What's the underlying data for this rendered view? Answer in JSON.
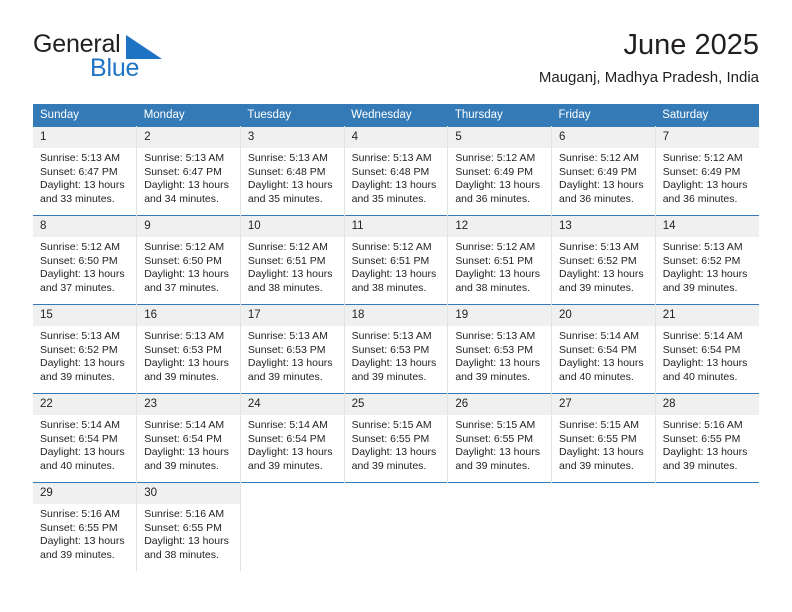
{
  "brand": {
    "name_part1": "General",
    "name_part2": "Blue",
    "logo_icon": "triangle-flag-icon",
    "accent_color": "#1f73c4"
  },
  "header": {
    "title": "June 2025",
    "location": "Mauganj, Madhya Pradesh, India"
  },
  "calendar": {
    "header_bg": "#337ab7",
    "daynum_bg": "#f0f0f0",
    "weekday_headers": [
      "Sunday",
      "Monday",
      "Tuesday",
      "Wednesday",
      "Thursday",
      "Friday",
      "Saturday"
    ],
    "weeks": [
      [
        {
          "day": "1",
          "sunrise": "Sunrise: 5:13 AM",
          "sunset": "Sunset: 6:47 PM",
          "daylight1": "Daylight: 13 hours",
          "daylight2": "and 33 minutes."
        },
        {
          "day": "2",
          "sunrise": "Sunrise: 5:13 AM",
          "sunset": "Sunset: 6:47 PM",
          "daylight1": "Daylight: 13 hours",
          "daylight2": "and 34 minutes."
        },
        {
          "day": "3",
          "sunrise": "Sunrise: 5:13 AM",
          "sunset": "Sunset: 6:48 PM",
          "daylight1": "Daylight: 13 hours",
          "daylight2": "and 35 minutes."
        },
        {
          "day": "4",
          "sunrise": "Sunrise: 5:13 AM",
          "sunset": "Sunset: 6:48 PM",
          "daylight1": "Daylight: 13 hours",
          "daylight2": "and 35 minutes."
        },
        {
          "day": "5",
          "sunrise": "Sunrise: 5:12 AM",
          "sunset": "Sunset: 6:49 PM",
          "daylight1": "Daylight: 13 hours",
          "daylight2": "and 36 minutes."
        },
        {
          "day": "6",
          "sunrise": "Sunrise: 5:12 AM",
          "sunset": "Sunset: 6:49 PM",
          "daylight1": "Daylight: 13 hours",
          "daylight2": "and 36 minutes."
        },
        {
          "day": "7",
          "sunrise": "Sunrise: 5:12 AM",
          "sunset": "Sunset: 6:49 PM",
          "daylight1": "Daylight: 13 hours",
          "daylight2": "and 36 minutes."
        }
      ],
      [
        {
          "day": "8",
          "sunrise": "Sunrise: 5:12 AM",
          "sunset": "Sunset: 6:50 PM",
          "daylight1": "Daylight: 13 hours",
          "daylight2": "and 37 minutes."
        },
        {
          "day": "9",
          "sunrise": "Sunrise: 5:12 AM",
          "sunset": "Sunset: 6:50 PM",
          "daylight1": "Daylight: 13 hours",
          "daylight2": "and 37 minutes."
        },
        {
          "day": "10",
          "sunrise": "Sunrise: 5:12 AM",
          "sunset": "Sunset: 6:51 PM",
          "daylight1": "Daylight: 13 hours",
          "daylight2": "and 38 minutes."
        },
        {
          "day": "11",
          "sunrise": "Sunrise: 5:12 AM",
          "sunset": "Sunset: 6:51 PM",
          "daylight1": "Daylight: 13 hours",
          "daylight2": "and 38 minutes."
        },
        {
          "day": "12",
          "sunrise": "Sunrise: 5:12 AM",
          "sunset": "Sunset: 6:51 PM",
          "daylight1": "Daylight: 13 hours",
          "daylight2": "and 38 minutes."
        },
        {
          "day": "13",
          "sunrise": "Sunrise: 5:13 AM",
          "sunset": "Sunset: 6:52 PM",
          "daylight1": "Daylight: 13 hours",
          "daylight2": "and 39 minutes."
        },
        {
          "day": "14",
          "sunrise": "Sunrise: 5:13 AM",
          "sunset": "Sunset: 6:52 PM",
          "daylight1": "Daylight: 13 hours",
          "daylight2": "and 39 minutes."
        }
      ],
      [
        {
          "day": "15",
          "sunrise": "Sunrise: 5:13 AM",
          "sunset": "Sunset: 6:52 PM",
          "daylight1": "Daylight: 13 hours",
          "daylight2": "and 39 minutes."
        },
        {
          "day": "16",
          "sunrise": "Sunrise: 5:13 AM",
          "sunset": "Sunset: 6:53 PM",
          "daylight1": "Daylight: 13 hours",
          "daylight2": "and 39 minutes."
        },
        {
          "day": "17",
          "sunrise": "Sunrise: 5:13 AM",
          "sunset": "Sunset: 6:53 PM",
          "daylight1": "Daylight: 13 hours",
          "daylight2": "and 39 minutes."
        },
        {
          "day": "18",
          "sunrise": "Sunrise: 5:13 AM",
          "sunset": "Sunset: 6:53 PM",
          "daylight1": "Daylight: 13 hours",
          "daylight2": "and 39 minutes."
        },
        {
          "day": "19",
          "sunrise": "Sunrise: 5:13 AM",
          "sunset": "Sunset: 6:53 PM",
          "daylight1": "Daylight: 13 hours",
          "daylight2": "and 39 minutes."
        },
        {
          "day": "20",
          "sunrise": "Sunrise: 5:14 AM",
          "sunset": "Sunset: 6:54 PM",
          "daylight1": "Daylight: 13 hours",
          "daylight2": "and 40 minutes."
        },
        {
          "day": "21",
          "sunrise": "Sunrise: 5:14 AM",
          "sunset": "Sunset: 6:54 PM",
          "daylight1": "Daylight: 13 hours",
          "daylight2": "and 40 minutes."
        }
      ],
      [
        {
          "day": "22",
          "sunrise": "Sunrise: 5:14 AM",
          "sunset": "Sunset: 6:54 PM",
          "daylight1": "Daylight: 13 hours",
          "daylight2": "and 40 minutes."
        },
        {
          "day": "23",
          "sunrise": "Sunrise: 5:14 AM",
          "sunset": "Sunset: 6:54 PM",
          "daylight1": "Daylight: 13 hours",
          "daylight2": "and 39 minutes."
        },
        {
          "day": "24",
          "sunrise": "Sunrise: 5:14 AM",
          "sunset": "Sunset: 6:54 PM",
          "daylight1": "Daylight: 13 hours",
          "daylight2": "and 39 minutes."
        },
        {
          "day": "25",
          "sunrise": "Sunrise: 5:15 AM",
          "sunset": "Sunset: 6:55 PM",
          "daylight1": "Daylight: 13 hours",
          "daylight2": "and 39 minutes."
        },
        {
          "day": "26",
          "sunrise": "Sunrise: 5:15 AM",
          "sunset": "Sunset: 6:55 PM",
          "daylight1": "Daylight: 13 hours",
          "daylight2": "and 39 minutes."
        },
        {
          "day": "27",
          "sunrise": "Sunrise: 5:15 AM",
          "sunset": "Sunset: 6:55 PM",
          "daylight1": "Daylight: 13 hours",
          "daylight2": "and 39 minutes."
        },
        {
          "day": "28",
          "sunrise": "Sunrise: 5:16 AM",
          "sunset": "Sunset: 6:55 PM",
          "daylight1": "Daylight: 13 hours",
          "daylight2": "and 39 minutes."
        }
      ],
      [
        {
          "day": "29",
          "sunrise": "Sunrise: 5:16 AM",
          "sunset": "Sunset: 6:55 PM",
          "daylight1": "Daylight: 13 hours",
          "daylight2": "and 39 minutes."
        },
        {
          "day": "30",
          "sunrise": "Sunrise: 5:16 AM",
          "sunset": "Sunset: 6:55 PM",
          "daylight1": "Daylight: 13 hours",
          "daylight2": "and 38 minutes."
        },
        {
          "day": "",
          "sunrise": "",
          "sunset": "",
          "daylight1": "",
          "daylight2": ""
        },
        {
          "day": "",
          "sunrise": "",
          "sunset": "",
          "daylight1": "",
          "daylight2": ""
        },
        {
          "day": "",
          "sunrise": "",
          "sunset": "",
          "daylight1": "",
          "daylight2": ""
        },
        {
          "day": "",
          "sunrise": "",
          "sunset": "",
          "daylight1": "",
          "daylight2": ""
        },
        {
          "day": "",
          "sunrise": "",
          "sunset": "",
          "daylight1": "",
          "daylight2": ""
        }
      ]
    ]
  }
}
